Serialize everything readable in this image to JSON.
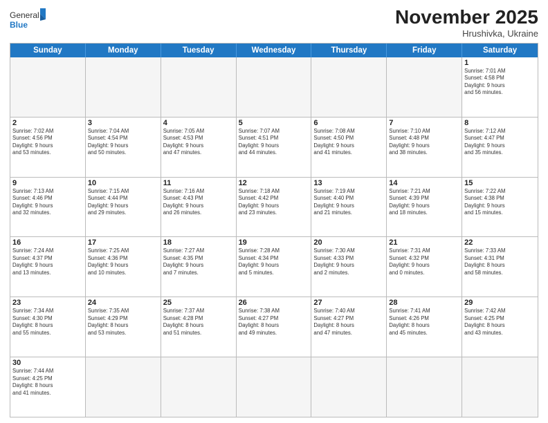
{
  "logo": {
    "general": "General",
    "blue": "Blue"
  },
  "title": "November 2025",
  "subtitle": "Hrushivka, Ukraine",
  "days": [
    "Sunday",
    "Monday",
    "Tuesday",
    "Wednesday",
    "Thursday",
    "Friday",
    "Saturday"
  ],
  "weeks": [
    [
      {
        "day": "",
        "empty": true
      },
      {
        "day": "",
        "empty": true
      },
      {
        "day": "",
        "empty": true
      },
      {
        "day": "",
        "empty": true
      },
      {
        "day": "",
        "empty": true
      },
      {
        "day": "",
        "empty": true
      },
      {
        "day": "1",
        "text": "Sunrise: 7:01 AM\nSunset: 4:58 PM\nDaylight: 9 hours\nand 56 minutes."
      }
    ],
    [
      {
        "day": "2",
        "text": "Sunrise: 7:02 AM\nSunset: 4:56 PM\nDaylight: 9 hours\nand 53 minutes."
      },
      {
        "day": "3",
        "text": "Sunrise: 7:04 AM\nSunset: 4:54 PM\nDaylight: 9 hours\nand 50 minutes."
      },
      {
        "day": "4",
        "text": "Sunrise: 7:05 AM\nSunset: 4:53 PM\nDaylight: 9 hours\nand 47 minutes."
      },
      {
        "day": "5",
        "text": "Sunrise: 7:07 AM\nSunset: 4:51 PM\nDaylight: 9 hours\nand 44 minutes."
      },
      {
        "day": "6",
        "text": "Sunrise: 7:08 AM\nSunset: 4:50 PM\nDaylight: 9 hours\nand 41 minutes."
      },
      {
        "day": "7",
        "text": "Sunrise: 7:10 AM\nSunset: 4:48 PM\nDaylight: 9 hours\nand 38 minutes."
      },
      {
        "day": "8",
        "text": "Sunrise: 7:12 AM\nSunset: 4:47 PM\nDaylight: 9 hours\nand 35 minutes."
      }
    ],
    [
      {
        "day": "9",
        "text": "Sunrise: 7:13 AM\nSunset: 4:46 PM\nDaylight: 9 hours\nand 32 minutes."
      },
      {
        "day": "10",
        "text": "Sunrise: 7:15 AM\nSunset: 4:44 PM\nDaylight: 9 hours\nand 29 minutes."
      },
      {
        "day": "11",
        "text": "Sunrise: 7:16 AM\nSunset: 4:43 PM\nDaylight: 9 hours\nand 26 minutes."
      },
      {
        "day": "12",
        "text": "Sunrise: 7:18 AM\nSunset: 4:42 PM\nDaylight: 9 hours\nand 23 minutes."
      },
      {
        "day": "13",
        "text": "Sunrise: 7:19 AM\nSunset: 4:40 PM\nDaylight: 9 hours\nand 21 minutes."
      },
      {
        "day": "14",
        "text": "Sunrise: 7:21 AM\nSunset: 4:39 PM\nDaylight: 9 hours\nand 18 minutes."
      },
      {
        "day": "15",
        "text": "Sunrise: 7:22 AM\nSunset: 4:38 PM\nDaylight: 9 hours\nand 15 minutes."
      }
    ],
    [
      {
        "day": "16",
        "text": "Sunrise: 7:24 AM\nSunset: 4:37 PM\nDaylight: 9 hours\nand 13 minutes."
      },
      {
        "day": "17",
        "text": "Sunrise: 7:25 AM\nSunset: 4:36 PM\nDaylight: 9 hours\nand 10 minutes."
      },
      {
        "day": "18",
        "text": "Sunrise: 7:27 AM\nSunset: 4:35 PM\nDaylight: 9 hours\nand 7 minutes."
      },
      {
        "day": "19",
        "text": "Sunrise: 7:28 AM\nSunset: 4:34 PM\nDaylight: 9 hours\nand 5 minutes."
      },
      {
        "day": "20",
        "text": "Sunrise: 7:30 AM\nSunset: 4:33 PM\nDaylight: 9 hours\nand 2 minutes."
      },
      {
        "day": "21",
        "text": "Sunrise: 7:31 AM\nSunset: 4:32 PM\nDaylight: 9 hours\nand 0 minutes."
      },
      {
        "day": "22",
        "text": "Sunrise: 7:33 AM\nSunset: 4:31 PM\nDaylight: 8 hours\nand 58 minutes."
      }
    ],
    [
      {
        "day": "23",
        "text": "Sunrise: 7:34 AM\nSunset: 4:30 PM\nDaylight: 8 hours\nand 55 minutes."
      },
      {
        "day": "24",
        "text": "Sunrise: 7:35 AM\nSunset: 4:29 PM\nDaylight: 8 hours\nand 53 minutes."
      },
      {
        "day": "25",
        "text": "Sunrise: 7:37 AM\nSunset: 4:28 PM\nDaylight: 8 hours\nand 51 minutes."
      },
      {
        "day": "26",
        "text": "Sunrise: 7:38 AM\nSunset: 4:27 PM\nDaylight: 8 hours\nand 49 minutes."
      },
      {
        "day": "27",
        "text": "Sunrise: 7:40 AM\nSunset: 4:27 PM\nDaylight: 8 hours\nand 47 minutes."
      },
      {
        "day": "28",
        "text": "Sunrise: 7:41 AM\nSunset: 4:26 PM\nDaylight: 8 hours\nand 45 minutes."
      },
      {
        "day": "29",
        "text": "Sunrise: 7:42 AM\nSunset: 4:25 PM\nDaylight: 8 hours\nand 43 minutes."
      }
    ],
    [
      {
        "day": "30",
        "text": "Sunrise: 7:44 AM\nSunset: 4:25 PM\nDaylight: 8 hours\nand 41 minutes."
      },
      {
        "day": "",
        "empty": true
      },
      {
        "day": "",
        "empty": true
      },
      {
        "day": "",
        "empty": true
      },
      {
        "day": "",
        "empty": true
      },
      {
        "day": "",
        "empty": true
      },
      {
        "day": "",
        "empty": true
      }
    ]
  ]
}
